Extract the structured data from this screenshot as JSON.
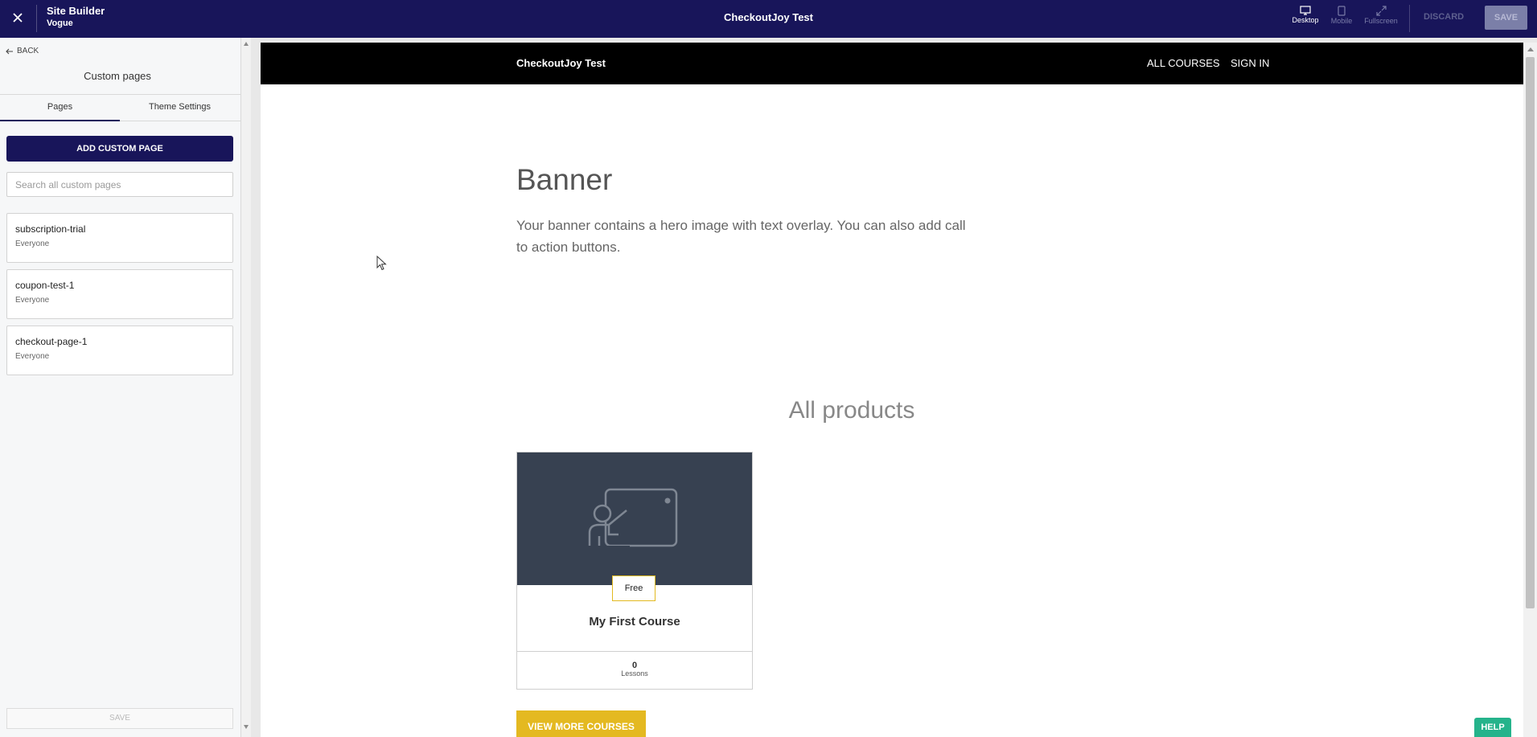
{
  "topbar": {
    "app_title": "Site Builder",
    "app_subtitle": "Vogue",
    "site_title": "CheckoutJoy Test",
    "views": [
      {
        "label": "Desktop",
        "icon": "desktop-icon",
        "active": true
      },
      {
        "label": "Mobile",
        "icon": "mobile-icon",
        "active": false
      },
      {
        "label": "Fullscreen",
        "icon": "fullscreen-icon",
        "active": false
      }
    ],
    "discard_label": "DISCARD",
    "save_label": "SAVE",
    "colors": {
      "bar": "#18155a",
      "save_disabled": "#7b7fa8"
    }
  },
  "sidebar": {
    "back_label": "BACK",
    "title": "Custom pages",
    "tabs": [
      {
        "label": "Pages",
        "active": true
      },
      {
        "label": "Theme Settings",
        "active": false
      }
    ],
    "add_button_label": "ADD CUSTOM PAGE",
    "search_placeholder": "Search all custom pages",
    "pages": [
      {
        "name": "subscription-trial",
        "audience": "Everyone"
      },
      {
        "name": "coupon-test-1",
        "audience": "Everyone"
      },
      {
        "name": "checkout-page-1",
        "audience": "Everyone"
      }
    ],
    "save_label": "SAVE"
  },
  "preview": {
    "brand": "CheckoutJoy Test",
    "nav_links": [
      "ALL COURSES",
      "SIGN IN"
    ],
    "banner": {
      "heading": "Banner",
      "text": "Your banner contains a hero image with text overlay. You can also add call to action buttons."
    },
    "products": {
      "heading": "All products",
      "courses": [
        {
          "price": "Free",
          "title": "My First Course",
          "lessons_count": "0",
          "lessons_label": "Lessons"
        }
      ],
      "more_button_label": "VIEW MORE COURSES"
    },
    "colors": {
      "accent": "#e4b921",
      "card_image": "#374151"
    }
  },
  "help_label": "HELP"
}
